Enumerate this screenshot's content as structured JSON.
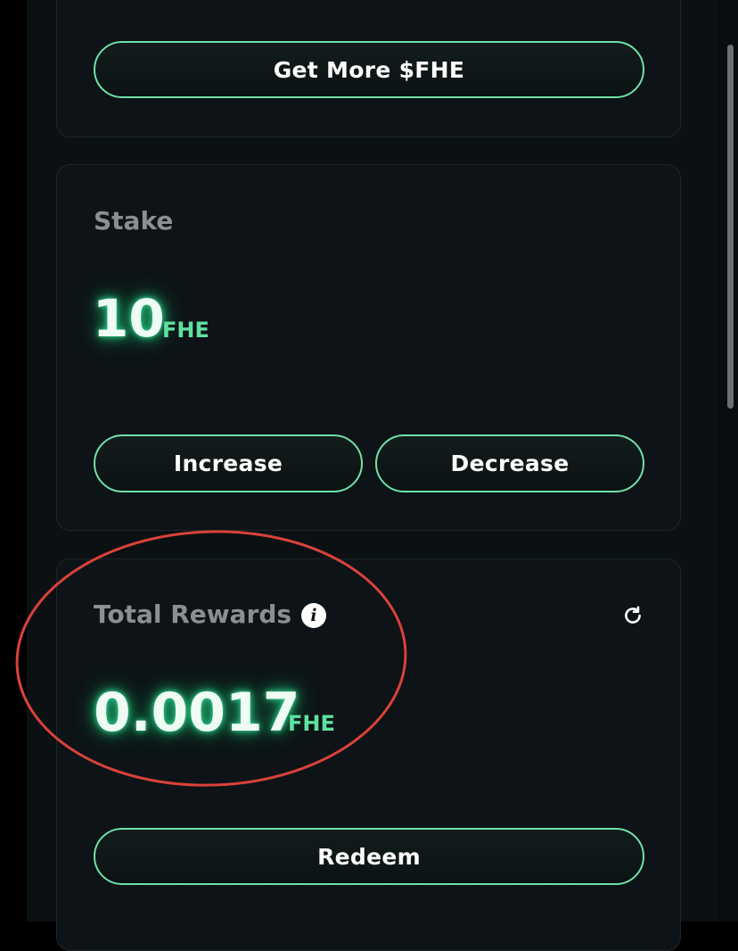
{
  "top_card": {
    "get_more_label": "Get More $FHE"
  },
  "stake": {
    "title": "Stake",
    "amount": "10",
    "unit": "FHE",
    "increase_label": "Increase",
    "decrease_label": "Decrease"
  },
  "rewards": {
    "title": "Total Rewards",
    "info_icon_glyph": "i",
    "amount": "0.0017",
    "unit": "FHE",
    "redeem_label": "Redeem"
  },
  "colors": {
    "accent": "#6ee2a9",
    "background": "#0b1013",
    "card": "#0d1316",
    "annotation": "#d9423a"
  }
}
